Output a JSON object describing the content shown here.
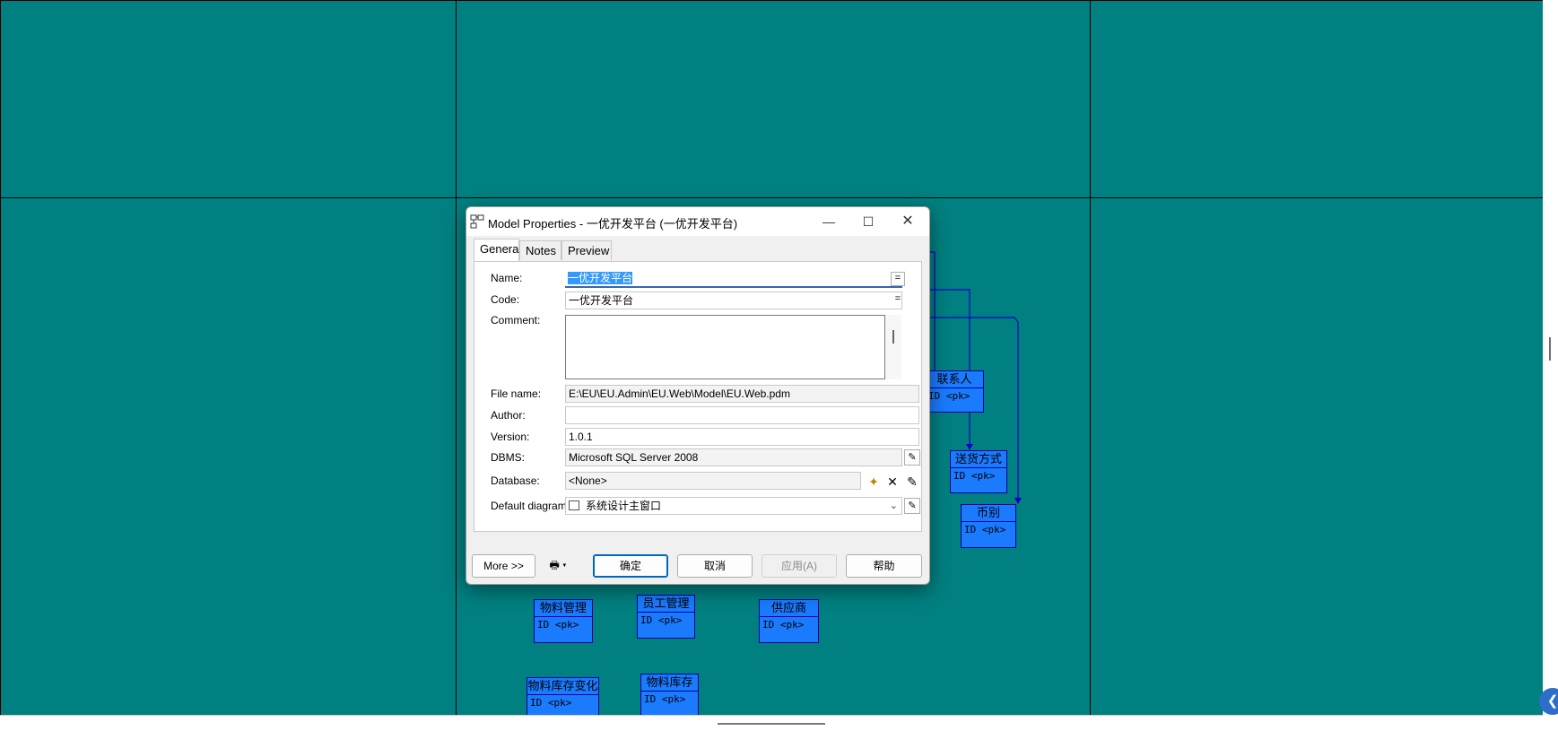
{
  "dialog": {
    "title": "Model Properties - 一优开发平台 (一优开发平台)",
    "tabs": [
      "General",
      "Notes",
      "Preview"
    ],
    "active_tab": "General",
    "fields": {
      "name_label": "Name:",
      "name_value": "一优开发平台",
      "code_label": "Code:",
      "code_value": "一优开发平台",
      "comment_label": "Comment:",
      "comment_value": "",
      "filename_label": "File name:",
      "filename_value": "E:\\EU\\EU.Admin\\EU.Web\\Model\\EU.Web.pdm",
      "author_label": "Author:",
      "author_value": "",
      "version_label": "Version:",
      "version_value": "1.0.1",
      "dbms_label": "DBMS:",
      "dbms_value": "Microsoft SQL Server 2008",
      "database_label": "Database:",
      "database_value": "<None>",
      "diagram_label": "Default diagram:",
      "diagram_value": "系统设计主窗口",
      "equals_symbol": "="
    },
    "buttons": {
      "more": "More >>",
      "ok": "确定",
      "cancel": "取消",
      "apply": "应用(A)",
      "help": "帮助"
    }
  },
  "entities": [
    {
      "title": "联系人",
      "attr": "ID <pk>"
    },
    {
      "title": "送货方式",
      "attr": "ID <pk>"
    },
    {
      "title": "币别",
      "attr": "ID <pk>"
    },
    {
      "title": "物料管理",
      "attr": "ID <pk>"
    },
    {
      "title": "员工管理",
      "attr": "ID <pk>"
    },
    {
      "title": "供应商",
      "attr": "ID <pk>"
    },
    {
      "title": "物料库存变化",
      "attr": "ID <pk>"
    },
    {
      "title": "物料库存",
      "attr": "ID <pk>"
    }
  ],
  "colors": {
    "canvas": "#008080",
    "entity_fill": "#1a7bff",
    "connector": "#0000cc",
    "accent": "#0067c0"
  }
}
